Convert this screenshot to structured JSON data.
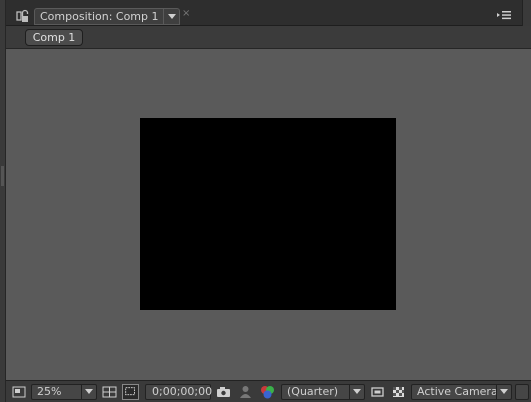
{
  "panel": {
    "tab_title": "Composition: Comp 1",
    "close_glyph": "×",
    "breadcrumb_label": "Comp 1"
  },
  "toolbar": {
    "zoom": "25%",
    "timecode": "0;00;00;00",
    "resolution": "(Quarter)",
    "view": "Active Camera"
  },
  "icons": [
    "lock-icon",
    "panel-menu-icon",
    "region-icon",
    "zoom-dropdown-icon",
    "grid-icon",
    "mask-icon",
    "camera-icon",
    "snapshot-icon",
    "color-channels-icon",
    "region-of-interest-icon",
    "transparency-grid-icon"
  ],
  "colors": {
    "viewer_bg": "#5a5a5a",
    "comp_bg": "#000000",
    "panel_bg": "#3a3a3a"
  }
}
